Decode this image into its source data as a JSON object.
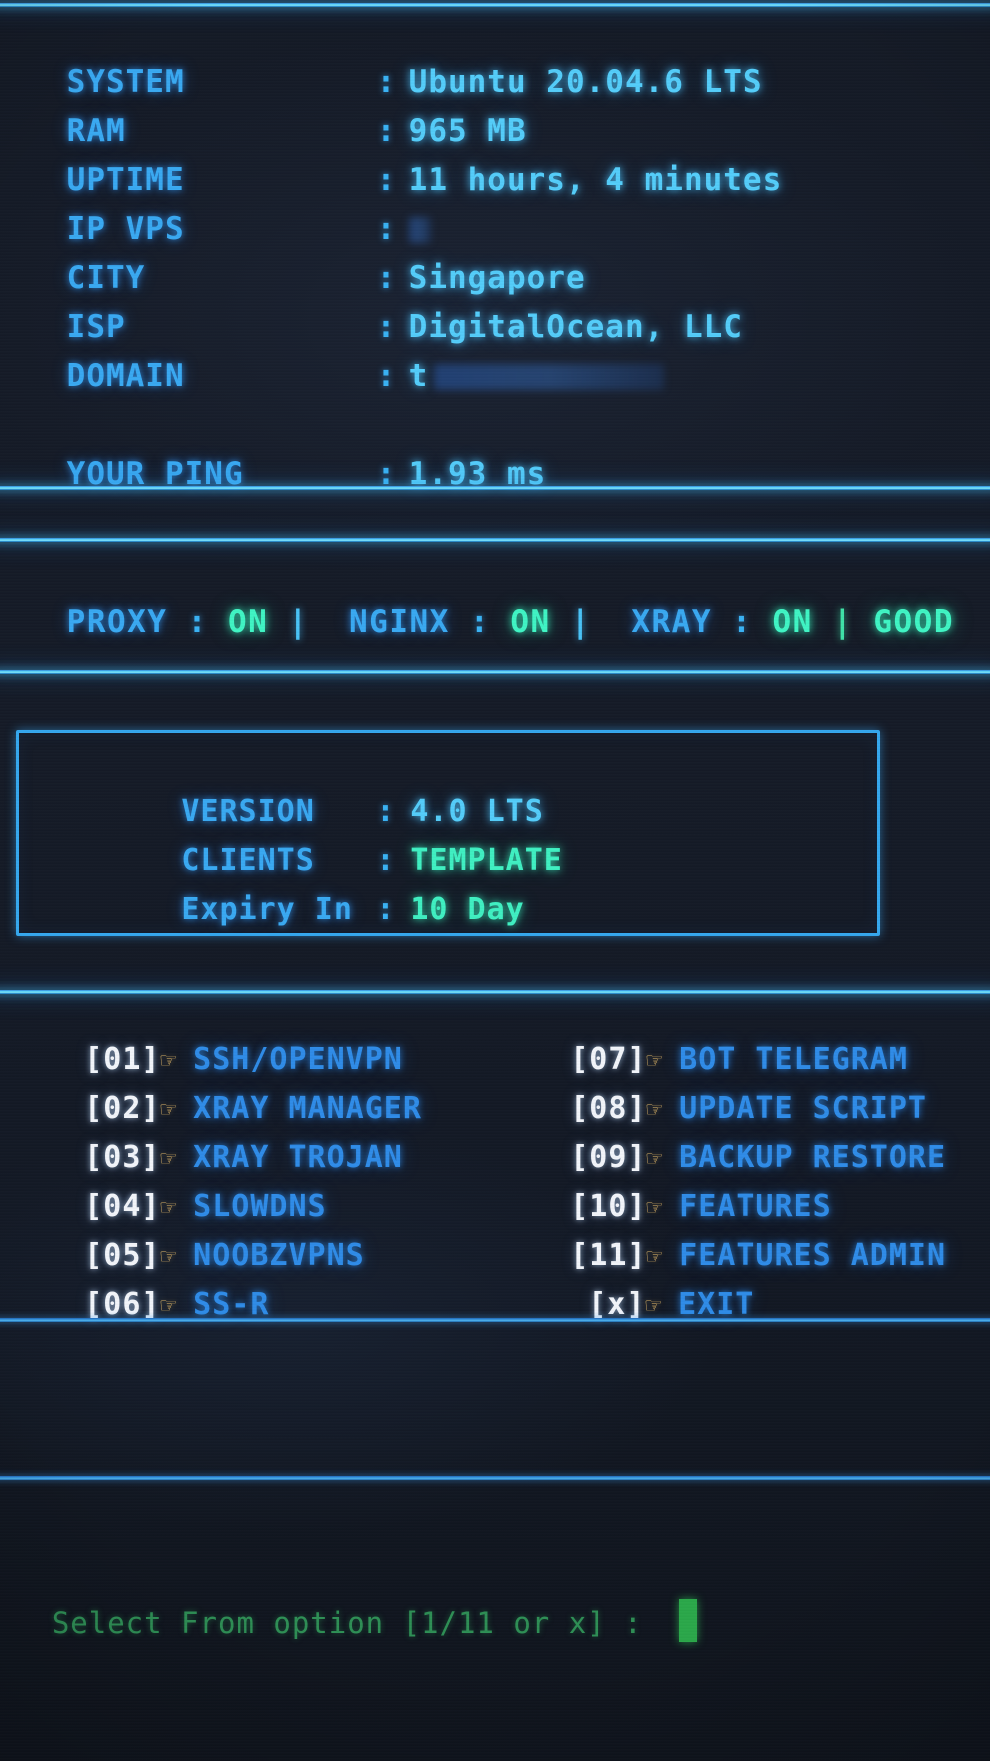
{
  "theme": {
    "bg": "#141a26",
    "label_blue": "#39a9f2",
    "value_cyan": "#54cdfa",
    "menu_blue": "#2f8ce8",
    "status_green": "#3ff5c4",
    "prompt_green": "#2e8f55",
    "divider_cyan": "#57d4fb",
    "number_white": "#f2f5fa",
    "hand_gold": "#e0b768"
  },
  "info": {
    "rows": [
      {
        "label": "SYSTEM",
        "colon": ":",
        "value": "Ubuntu 20.04.6 LTS",
        "redacted": false
      },
      {
        "label": "RAM",
        "colon": ":",
        "value": "965 MB",
        "redacted": false
      },
      {
        "label": "UPTIME",
        "colon": ":",
        "value": "11 hours, 4 minutes",
        "redacted": false
      },
      {
        "label": "IP VPS",
        "colon": ":",
        "value": "",
        "redacted": true
      },
      {
        "label": "CITY",
        "colon": ":",
        "value": "Singapore",
        "redacted": false
      },
      {
        "label": "ISP",
        "colon": ":",
        "value": "DigitalOcean, LLC",
        "redacted": false
      },
      {
        "label": "DOMAIN",
        "colon": ":",
        "value": "t",
        "redacted": true
      }
    ],
    "ping": {
      "label": "YOUR PING",
      "colon": ":",
      "value": "1.93 ms"
    }
  },
  "status": {
    "services": [
      {
        "name": "PROXY",
        "colon": ":",
        "state": "ON"
      },
      {
        "name": "NGINX",
        "colon": ":",
        "state": "ON"
      },
      {
        "name": "XRAY",
        "colon": ":",
        "state": "ON"
      }
    ],
    "separator": "|",
    "overall": "GOOD"
  },
  "version_box": {
    "rows": [
      {
        "label": "VERSION",
        "colon": ":",
        "value": "4.0 LTS",
        "tone": "cyan"
      },
      {
        "label": "CLIENTS",
        "colon": ":",
        "value": "TEMPLATE",
        "tone": "green"
      },
      {
        "label": "Expiry In",
        "colon": ":",
        "value": "10 Day",
        "tone": "green"
      }
    ]
  },
  "menu": {
    "pointer_icon": "☞",
    "left_column": [
      {
        "key": "[01]",
        "label": "SSH/OPENVPN"
      },
      {
        "key": "[02]",
        "label": "XRAY MANAGER"
      },
      {
        "key": "[03]",
        "label": "XRAY TROJAN"
      },
      {
        "key": "[04]",
        "label": "SLOWDNS"
      },
      {
        "key": "[05]",
        "label": "NOOBZVPNS"
      },
      {
        "key": "[06]",
        "label": "SS-R"
      }
    ],
    "right_column": [
      {
        "key": "[07]",
        "label": "BOT TELEGRAM"
      },
      {
        "key": "[08]",
        "label": "UPDATE SCRIPT"
      },
      {
        "key": "[09]",
        "label": "BACKUP RESTORE"
      },
      {
        "key": "[10]",
        "label": "FEATURES"
      },
      {
        "key": "[11]",
        "label": "FEATURES ADMIN"
      },
      {
        "key": "[x]",
        "label": "EXIT"
      }
    ]
  },
  "prompt": {
    "text": "Select From option [1/11 or x] :",
    "cursor": "█"
  }
}
